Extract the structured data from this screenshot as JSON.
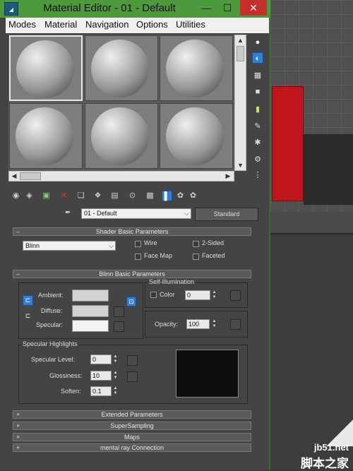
{
  "window": {
    "title": "Material Editor - 01 - Default",
    "minimize": "—",
    "maximize": "☐",
    "close": "✕"
  },
  "menu": [
    "Modes",
    "Material",
    "Navigation",
    "Options",
    "Utilities"
  ],
  "material": {
    "name": "01 - Default",
    "type_button": "Standard"
  },
  "shader_basic": {
    "header": "Shader Basic Parameters",
    "toggle": "–",
    "shader": "Blinn",
    "wire": "Wire",
    "two_sided": "2-Sided",
    "face_map": "Face Map",
    "faceted": "Faceted"
  },
  "blinn_basic": {
    "header": "Blinn Basic Parameters",
    "toggle": "–",
    "ambient": "Ambient:",
    "diffuse": "Diffuse:",
    "specular": "Specular:",
    "self_illum_title": "Self-Illumination",
    "color_label": "Color",
    "color_value": "0",
    "opacity_label": "Opacity:",
    "opacity_value": "100"
  },
  "specular_highlights": {
    "title": "Specular Highlights",
    "level_label": "Specular Level:",
    "level_value": "0",
    "gloss_label": "Glossiness:",
    "gloss_value": "10",
    "soften_label": "Soften:",
    "soften_value": "0.1"
  },
  "rollouts": [
    {
      "toggle": "+",
      "label": "Extended Parameters"
    },
    {
      "toggle": "+",
      "label": "SuperSampling"
    },
    {
      "toggle": "+",
      "label": "Maps"
    },
    {
      "toggle": "+",
      "label": "mental ray Connection"
    }
  ],
  "watermark": {
    "site": "jb51.net",
    "brand": "脚本之家"
  },
  "colors": {
    "titlebar": "#4c9a3c",
    "panel_bg": "#444444",
    "viewport_red": "#c0161b",
    "active_tool": "#2f7fd8"
  }
}
